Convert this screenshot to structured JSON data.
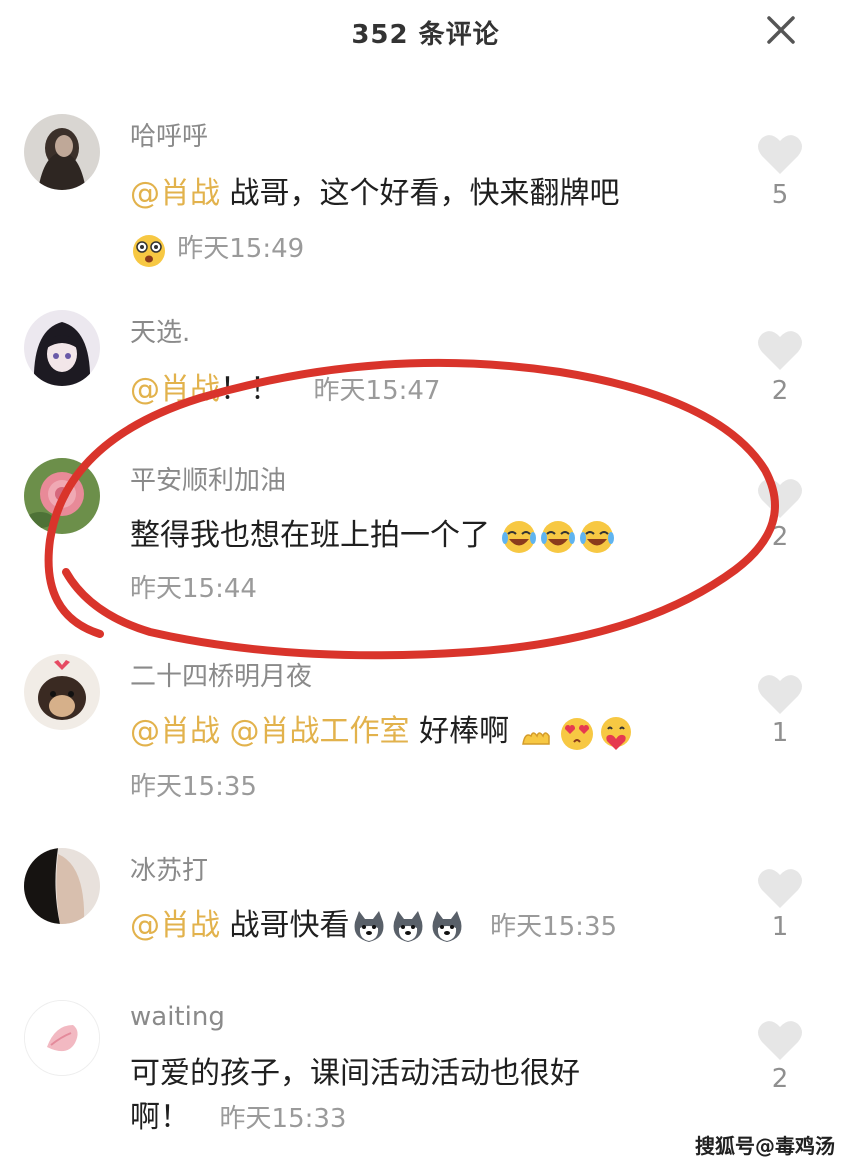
{
  "header": {
    "title": "352 条评论"
  },
  "comments": [
    {
      "username": "哈呼呼",
      "mention": "@肖战",
      "text": " 战哥，这个好看，快来翻牌吧",
      "time": "昨天15:49",
      "likes": "5"
    },
    {
      "username": "天选.",
      "mention": "@肖战",
      "text": "！！",
      "time": "昨天15:47",
      "likes": "2"
    },
    {
      "username": "平安顺利加油",
      "text": "整得我也想在班上拍一个了",
      "time": "昨天15:44",
      "likes": "2"
    },
    {
      "username": "二十四桥明月夜",
      "mention": "@肖战 @肖战工作室",
      "text": " 好棒啊",
      "time": "昨天15:35",
      "likes": "1"
    },
    {
      "username": "冰苏打",
      "mention": "@肖战",
      "text": " 战哥快看",
      "time": "昨天15:35",
      "likes": "1"
    },
    {
      "username": "waiting",
      "text_line1": "可爱的孩子，课间活动活动也很好",
      "text_line2": "啊！",
      "time": "昨天15:33",
      "likes": "2"
    }
  ],
  "watermark": "搜狐号@毒鸡汤",
  "colors": {
    "mention": "#e2b24c",
    "annotation_circle": "#d9342b"
  },
  "icons": [
    "close-icon",
    "heart-icon",
    "avatar",
    "emoji"
  ]
}
